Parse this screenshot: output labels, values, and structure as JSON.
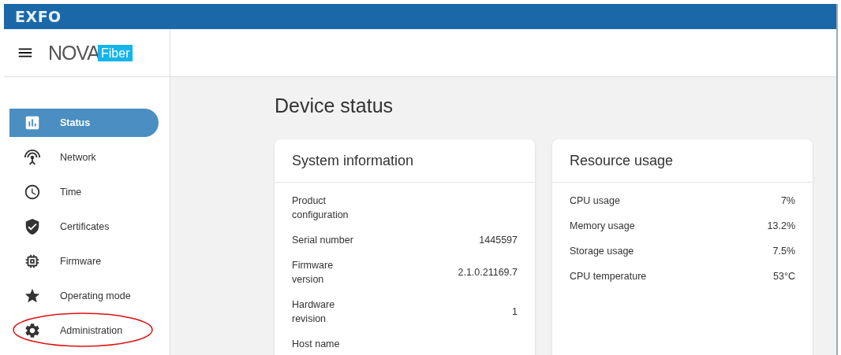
{
  "topbar": {
    "brand": "EXFO"
  },
  "app_logo": {
    "primary": "NOVA",
    "secondary": "Fiber"
  },
  "sidebar": {
    "items": [
      {
        "label": "Status",
        "kind": "status",
        "selected": true,
        "highlighted": false
      },
      {
        "label": "Network",
        "kind": "network",
        "selected": false,
        "highlighted": false
      },
      {
        "label": "Time",
        "kind": "time",
        "selected": false,
        "highlighted": false
      },
      {
        "label": "Certificates",
        "kind": "certificates",
        "selected": false,
        "highlighted": false
      },
      {
        "label": "Firmware",
        "kind": "firmware",
        "selected": false,
        "highlighted": false
      },
      {
        "label": "Operating mode",
        "kind": "mode",
        "selected": false,
        "highlighted": false
      },
      {
        "label": "Administration",
        "kind": "admin",
        "selected": false,
        "highlighted": true
      }
    ]
  },
  "page_title": "Device status",
  "cards": [
    {
      "title": "System information",
      "rows": [
        {
          "label": "Product configuration"
        },
        {
          "label": "Serial number",
          "value": "1445597"
        },
        {
          "label": "Firmware version",
          "value": "2.1.0.21169.7"
        },
        {
          "label": "Hardware revision",
          "value": "1"
        },
        {
          "label": "Host name"
        }
      ]
    },
    {
      "title": "Resource usage",
      "rows": [
        {
          "label": "CPU usage",
          "value": "7%"
        },
        {
          "label": "Memory usage",
          "value": "13.2%"
        },
        {
          "label": "Storage usage",
          "value": "7.5%"
        },
        {
          "label": "CPU temperature",
          "value": "53°C"
        }
      ]
    }
  ]
}
